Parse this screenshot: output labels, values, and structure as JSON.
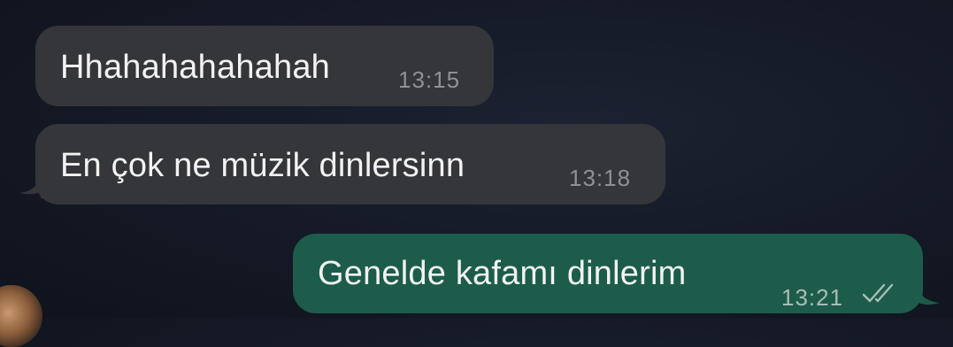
{
  "messages": [
    {
      "direction": "incoming",
      "text": "Hhahahahahahah",
      "time": "13:15"
    },
    {
      "direction": "incoming",
      "text": "En çok ne müzik dinlersinn",
      "time": "13:18"
    },
    {
      "direction": "outgoing",
      "text": "Genelde kafamı dinlerim",
      "time": "13:21",
      "status": "read",
      "status_icon": "double-check-icon"
    }
  ],
  "colors": {
    "incoming_bubble": "#35363a",
    "outgoing_bubble": "#1d5c4b",
    "background": "#141925",
    "text": "#f2f2f2",
    "timestamp": "#8e9097"
  }
}
